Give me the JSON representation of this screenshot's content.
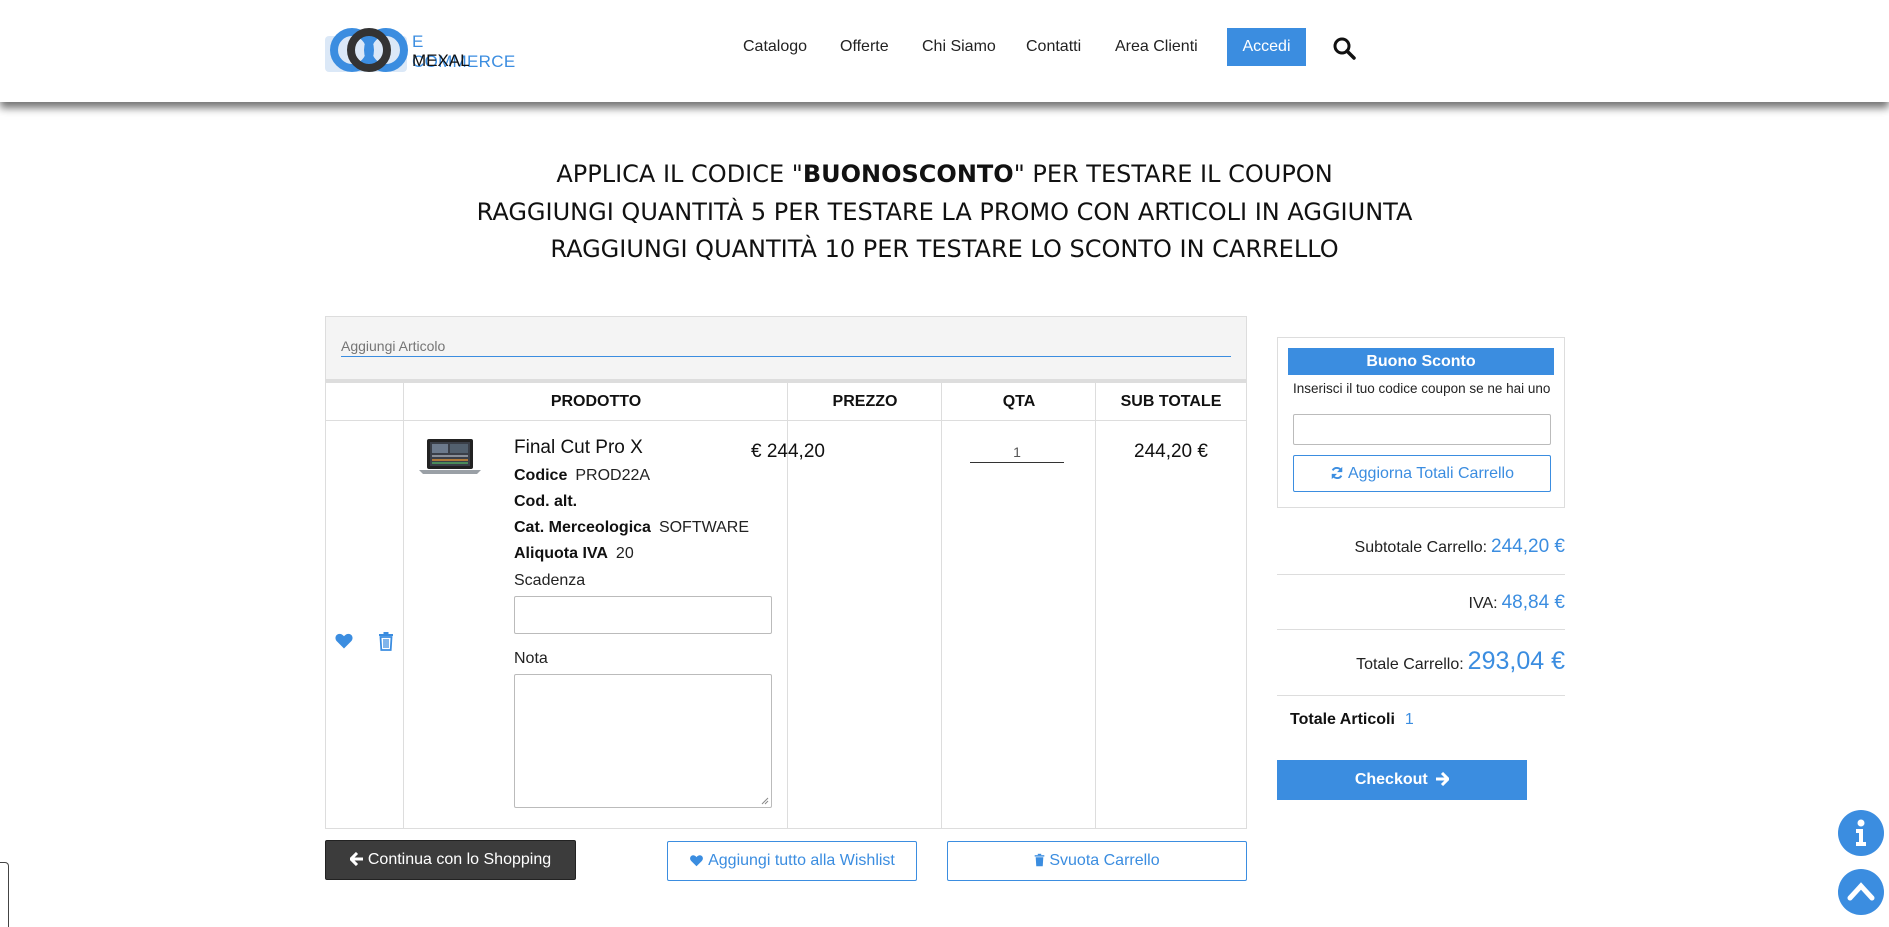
{
  "header": {
    "logo_line1": "E COMMERCE",
    "logo_line2": "MEXAL",
    "nav": [
      "Catalogo",
      "Offerte",
      "Chi Siamo",
      "Contatti",
      "Area Clienti"
    ],
    "login_label": "Accedi",
    "search_icon": "search-icon"
  },
  "announcement": {
    "line1_before": "APPLICA IL CODICE \"",
    "line1_bold": "BUONOSCONTO",
    "line1_after": "\" PER TESTARE IL COUPON",
    "line2": "RAGGIUNGI QUANTITÀ 5 PER TESTARE LA PROMO CON ARTICOLI IN AGGIUNTA",
    "line3": "RAGGIUNGI QUANTITÀ 10 PER TESTARE LO SCONTO IN CARRELLO"
  },
  "add_article": {
    "placeholder": "Aggiungi Articolo"
  },
  "table": {
    "headers": [
      "PRODOTTO",
      "PREZZO",
      "QTA",
      "SUB TOTALE"
    ],
    "item": {
      "name": "Final Cut Pro X",
      "codice_label": "Codice",
      "codice": "PROD22A",
      "cod_alt_label": "Cod. alt.",
      "cat_label": "Cat. Merceologica",
      "cat": "SOFTWARE",
      "iva_label": "Aliquota IVA",
      "iva": "20",
      "scadenza_label": "Scadenza",
      "nota_label": "Nota",
      "price": "€ 244,20",
      "qty": "1",
      "subtotal": "244,20 €"
    }
  },
  "actions": {
    "continue": "Continua con lo Shopping",
    "wishlist_all": "Aggiungi tutto alla Wishlist",
    "empty_cart": "Svuota Carrello"
  },
  "coupon": {
    "title": "Buono Sconto",
    "hint": "Inserisci il tuo codice coupon se ne hai uno",
    "update_button": "Aggiorna Totali Carrello"
  },
  "summary": {
    "subtotal_label": "Subtotale Carrello:",
    "subtotal": "244,20 €",
    "iva_label": "IVA:",
    "iva": "48,84 €",
    "total_label": "Totale Carrello:",
    "total": "293,04 €",
    "articles_label": "Totale Articoli",
    "articles": "1",
    "checkout": "Checkout"
  },
  "colors": {
    "accent": "#3b8de0",
    "dark_button": "#3c3c3c"
  }
}
